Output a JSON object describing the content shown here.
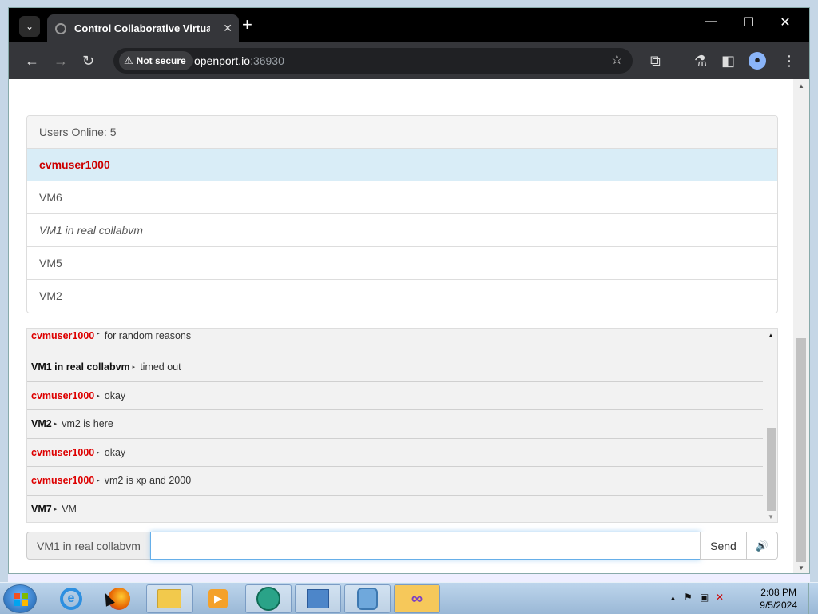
{
  "browser": {
    "tab_title": "Control Collaborative Virtual M",
    "new_tab_label": "+",
    "security_label": "Not secure",
    "url_host": "openport.io",
    "url_port": ":36930",
    "icons": [
      "back-icon",
      "forward-icon",
      "reload-icon",
      "star-icon",
      "extensions-icon",
      "labs-icon",
      "sidepanel-icon",
      "profile-icon",
      "menu-icon"
    ]
  },
  "users_panel": {
    "header": "Users Online: 5",
    "users": [
      {
        "name": "cvmuser1000",
        "style": "self"
      },
      {
        "name": "VM6",
        "style": "normal"
      },
      {
        "name": "VM1 in real collabvm",
        "style": "italic"
      },
      {
        "name": "VM5",
        "style": "normal"
      },
      {
        "name": "VM2",
        "style": "normal"
      }
    ]
  },
  "chat": {
    "messages": [
      {
        "user": "cvmuser1000",
        "self": true,
        "text": "for random reasons"
      },
      {
        "user": "VM1 in real collabvm",
        "self": false,
        "text": "timed out"
      },
      {
        "user": "cvmuser1000",
        "self": true,
        "text": "okay"
      },
      {
        "user": "VM2",
        "self": false,
        "text": "vm2 is here"
      },
      {
        "user": "cvmuser1000",
        "self": true,
        "text": "okay"
      },
      {
        "user": "cvmuser1000",
        "self": true,
        "text": "vm2 is xp and 2000"
      },
      {
        "user": "VM7",
        "self": false,
        "text": "VM"
      }
    ],
    "separator_glyph": "▸"
  },
  "composer": {
    "nickname": "VM1 in real collabvm",
    "input_value": "",
    "send_label": "Send",
    "volume_glyph": "🔊"
  },
  "taskbar": {
    "clock_time": "2:08 PM",
    "clock_date": "9/5/2024",
    "apps": [
      "internet-explorer",
      "firefox",
      "windows-explorer",
      "media-center",
      "media-player",
      "control-panel",
      "tools",
      "visual-studio"
    ]
  },
  "colors": {
    "self_user": "#cc0000",
    "self_row_bg": "#d9edf7",
    "chrome_dark": "#35363a"
  }
}
